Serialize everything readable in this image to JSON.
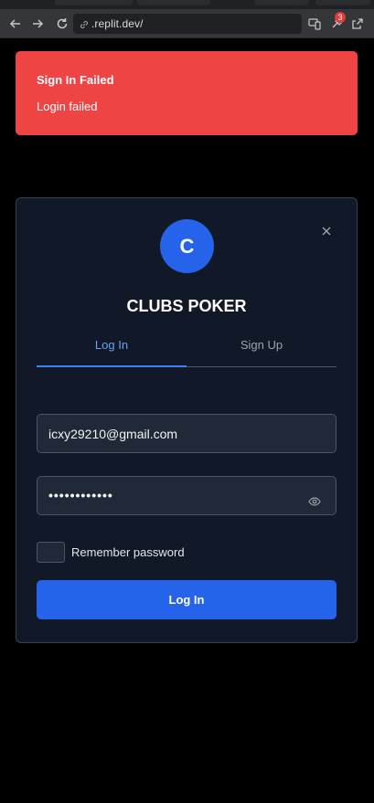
{
  "browser": {
    "url": ".replit.dev/",
    "extension_badge": "3"
  },
  "toast": {
    "title": "Sign In Failed",
    "message": "Login failed",
    "color": "#ef4444"
  },
  "modal": {
    "logo_letter": "C",
    "brand": "CLUBS POKER",
    "tabs": [
      {
        "label": "Log In",
        "active": true
      },
      {
        "label": "Sign Up",
        "active": false
      }
    ],
    "email_value": "icxy29210@gmail.com",
    "password_mask": "••••••••••••",
    "remember_label": "Remember password",
    "remember_checked": false,
    "submit_label": "Log In",
    "accent_color": "#2563eb"
  }
}
